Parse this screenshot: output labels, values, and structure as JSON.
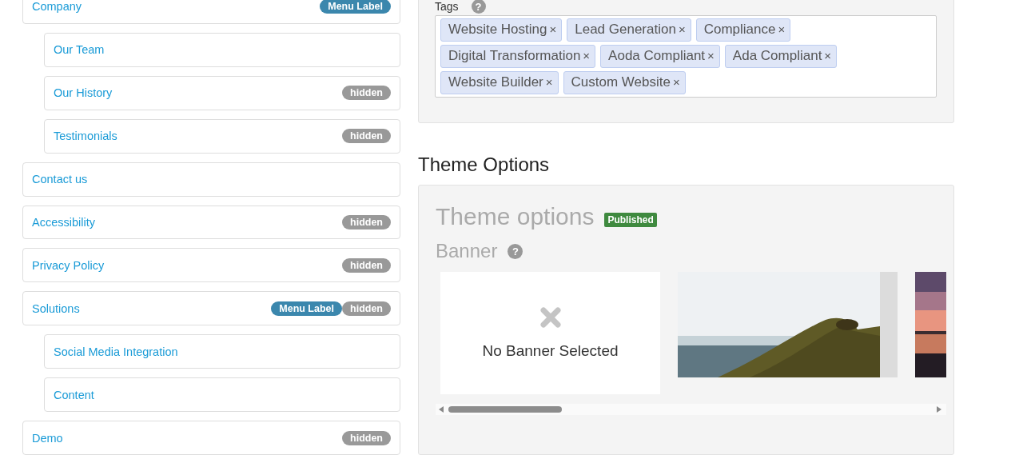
{
  "menu_items": [
    {
      "label": "Company",
      "badges": [
        {
          "kind": "menu-label",
          "text": "Menu Label"
        }
      ],
      "children": [
        {
          "label": "Our Team"
        },
        {
          "label": "Our History",
          "badges": [
            {
              "kind": "hidden",
              "text": "hidden"
            }
          ]
        },
        {
          "label": "Testimonials",
          "badges": [
            {
              "kind": "hidden",
              "text": "hidden"
            }
          ]
        }
      ]
    },
    {
      "label": "Contact us"
    },
    {
      "label": "Accessibility",
      "badges": [
        {
          "kind": "hidden",
          "text": "hidden"
        }
      ]
    },
    {
      "label": "Privacy Policy",
      "badges": [
        {
          "kind": "hidden",
          "text": "hidden"
        }
      ]
    },
    {
      "label": "Solutions",
      "badges": [
        {
          "kind": "menu-label",
          "text": "Menu Label"
        },
        {
          "kind": "hidden",
          "text": "hidden"
        }
      ],
      "children": [
        {
          "label": "Social Media Integration"
        },
        {
          "label": "Content"
        }
      ]
    },
    {
      "label": "Demo",
      "badges": [
        {
          "kind": "hidden",
          "text": "hidden"
        }
      ]
    }
  ],
  "tags_field": {
    "label": "Tags",
    "help": "?",
    "tags": [
      "Website Hosting",
      "Lead Generation",
      "Compliance",
      "Digital Transformation",
      "Aoda Compliant",
      "Ada Compliant",
      "Website Builder",
      "Custom Website"
    ],
    "remove": "×"
  },
  "theme_section": {
    "heading": "Theme Options",
    "panel_title": "Theme options",
    "status": "Published",
    "banner_label": "Banner",
    "banner_help": "?",
    "banners": [
      {
        "kind": "empty",
        "text": "No Banner Selected"
      },
      {
        "kind": "picture"
      },
      {
        "kind": "picture"
      }
    ]
  }
}
